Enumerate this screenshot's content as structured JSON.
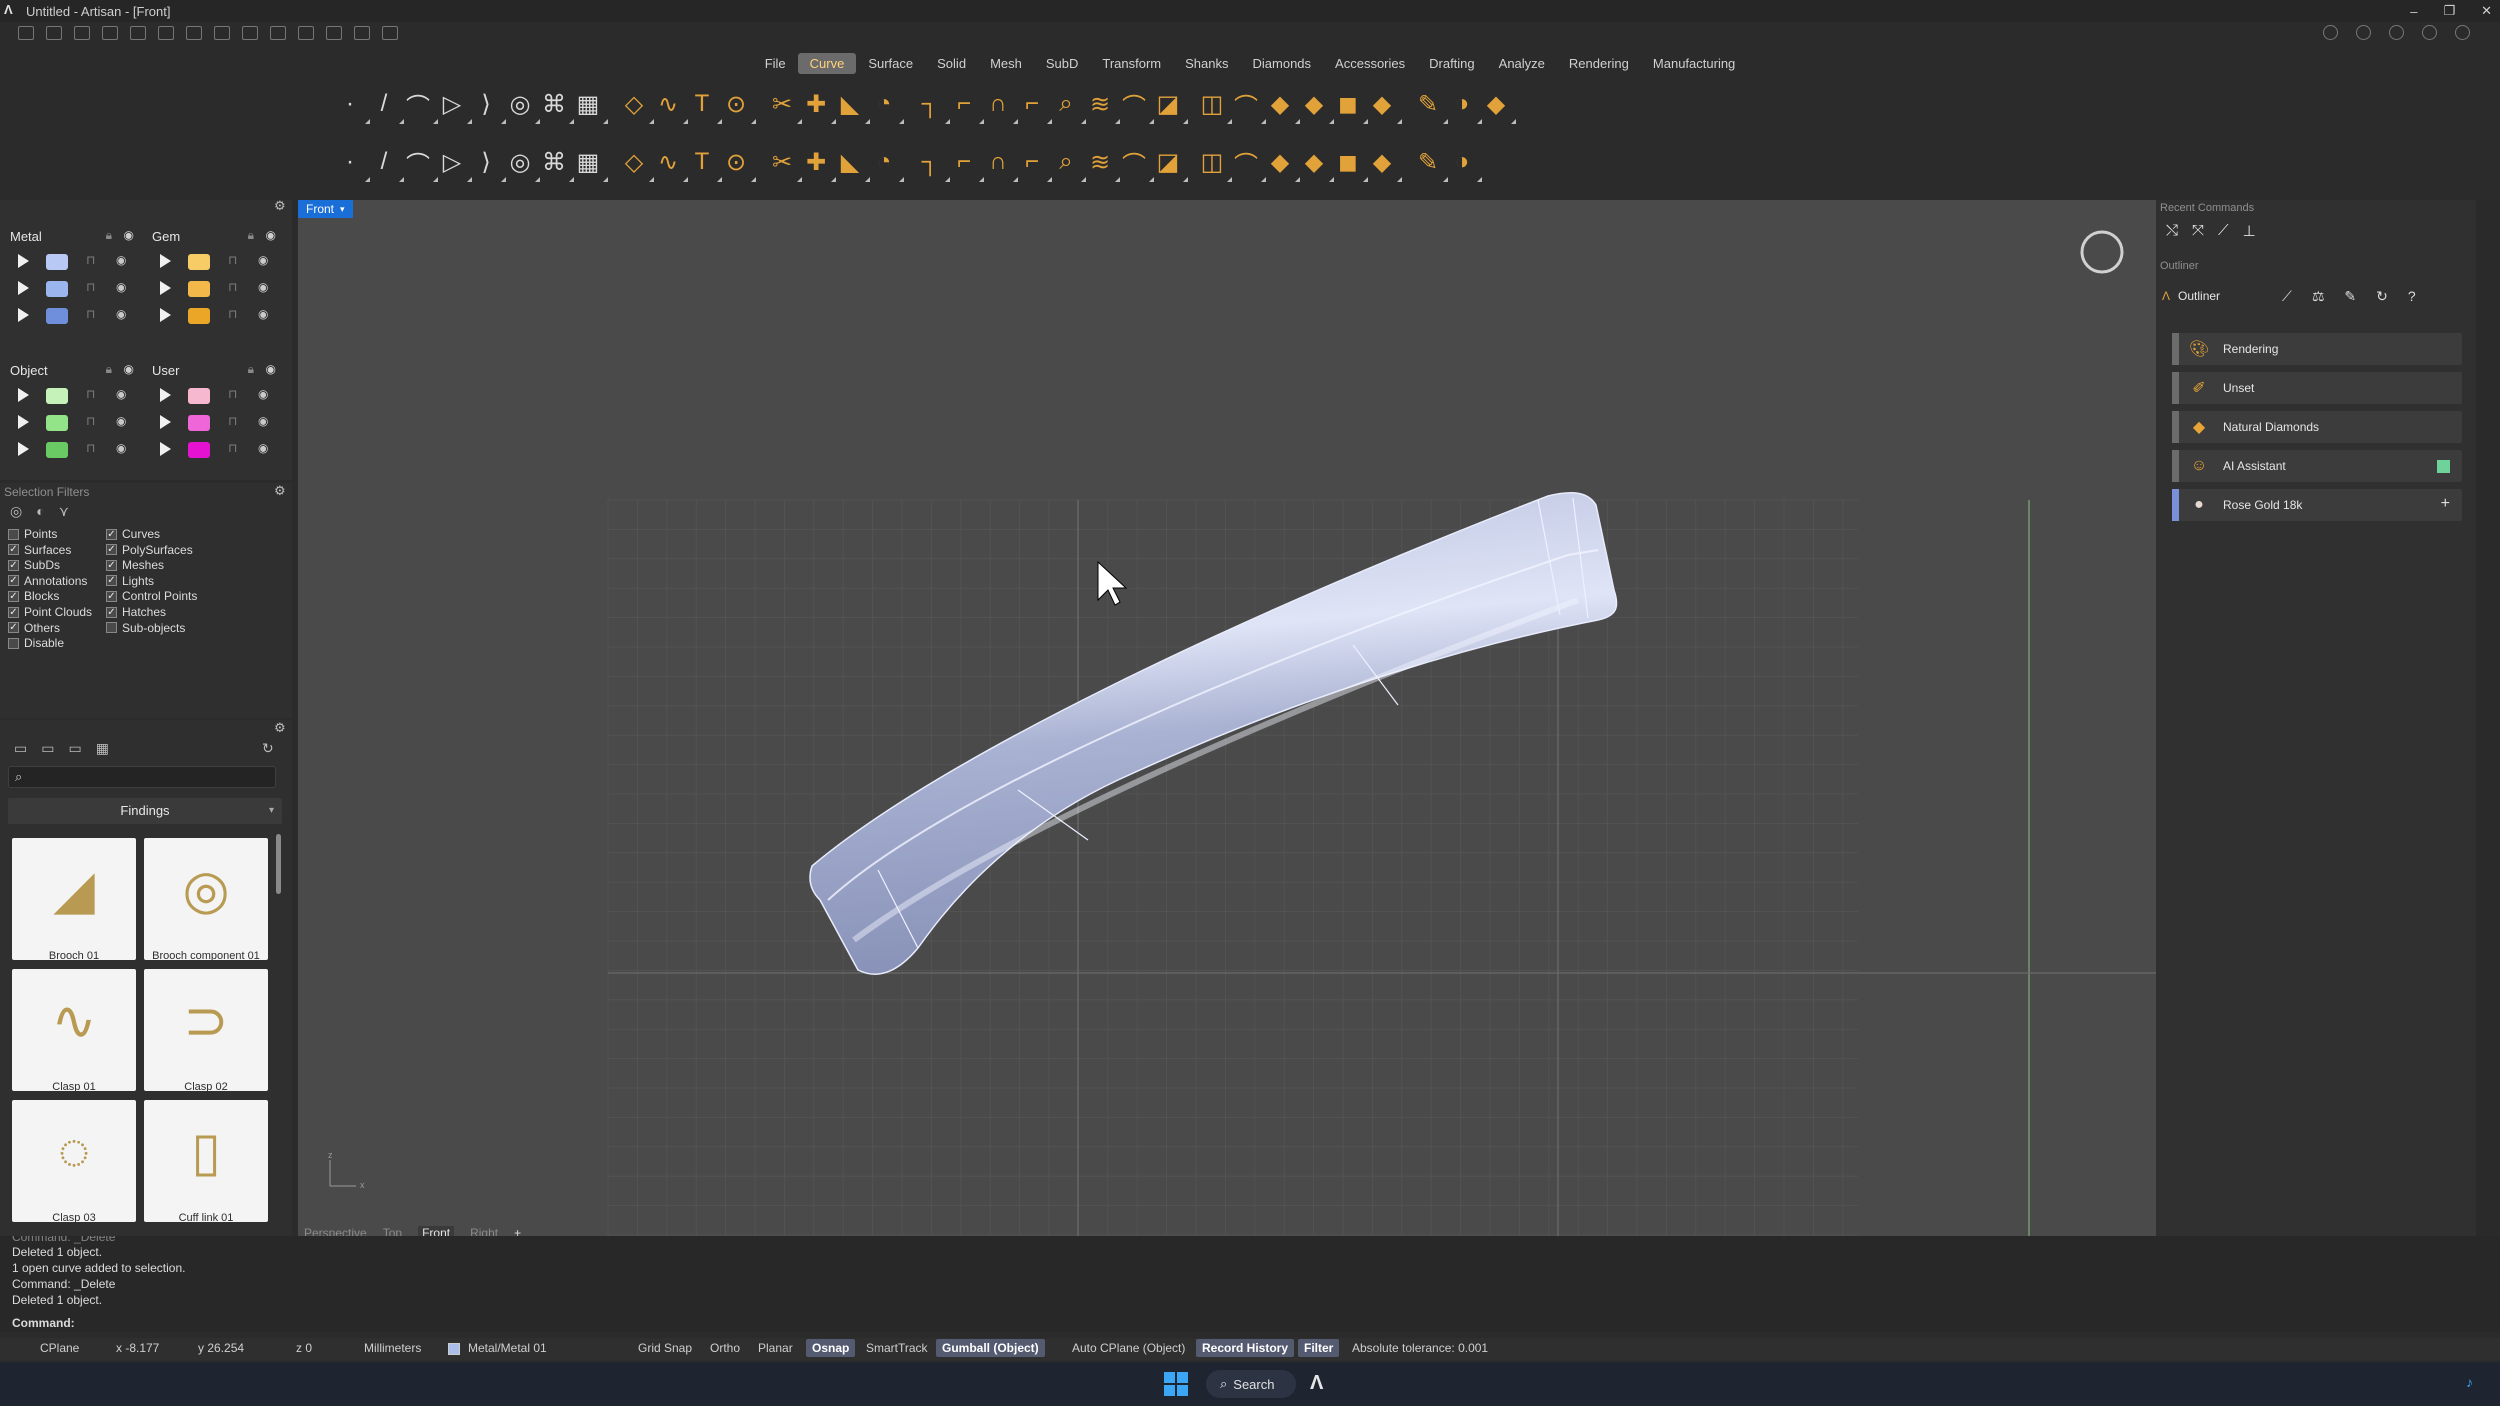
{
  "window": {
    "title": "Untitled - Artisan - [Front]",
    "buttons": [
      "–",
      "❐",
      "✕"
    ]
  },
  "menu": {
    "tabs": [
      "File",
      "Curve",
      "Surface",
      "Solid",
      "Mesh",
      "SubD",
      "Transform",
      "Shanks",
      "Diamonds",
      "Accessories",
      "Drafting",
      "Analyze",
      "Rendering",
      "Manufacturing"
    ],
    "active": "Curve"
  },
  "layers": {
    "groups": [
      {
        "name": "Metal",
        "colors": [
          "#b9c9f5",
          "#9bb6ef",
          "#6f8fdc"
        ]
      },
      {
        "name": "Gem",
        "colors": [
          "#f7cb66",
          "#f3b84a",
          "#eba628"
        ]
      },
      {
        "name": "Object",
        "colors": [
          "#c5f2b8",
          "#93e389",
          "#6acb65"
        ]
      },
      {
        "name": "User",
        "colors": [
          "#f6b8cf",
          "#ee66d8",
          "#e512d1"
        ]
      }
    ]
  },
  "selection_filters": {
    "title": "Selection Filters",
    "left": [
      {
        "label": "Points",
        "checked": false
      },
      {
        "label": "Surfaces",
        "checked": true
      },
      {
        "label": "SubDs",
        "checked": true
      },
      {
        "label": "Annotations",
        "checked": true
      },
      {
        "label": "Blocks",
        "checked": true
      },
      {
        "label": "Point Clouds",
        "checked": true
      },
      {
        "label": "Others",
        "checked": true
      },
      {
        "label": "Disable",
        "checked": false
      }
    ],
    "right": [
      {
        "label": "Curves",
        "checked": true
      },
      {
        "label": "PolySurfaces",
        "checked": true
      },
      {
        "label": "Meshes",
        "checked": true
      },
      {
        "label": "Lights",
        "checked": true
      },
      {
        "label": "Control Points",
        "checked": true
      },
      {
        "label": "Hatches",
        "checked": true
      },
      {
        "label": "Sub-objects",
        "checked": false
      }
    ]
  },
  "library": {
    "category": "Findings",
    "items": [
      "Brooch 01",
      "Brooch component 01",
      "Clasp 01",
      "Clasp 02",
      "Clasp 03",
      "Cuff link 01"
    ]
  },
  "viewport": {
    "active_view": "Front",
    "view_tabs": [
      "Perspective",
      "Top",
      "Front",
      "Right"
    ],
    "add_tab": "+",
    "axis_z": "z",
    "axis_x": "x"
  },
  "recent_commands": {
    "title": "Recent Commands"
  },
  "outliner": {
    "section": "Outliner",
    "title": "Outliner",
    "items": [
      {
        "label": "Rendering",
        "icon": "palette-icon"
      },
      {
        "label": "Unset",
        "icon": "brush-icon"
      },
      {
        "label": "Natural Diamonds",
        "icon": "diamond-icon"
      },
      {
        "label": "AI Assistant",
        "icon": "assistant-icon"
      },
      {
        "label": "Rose Gold 18k",
        "icon": "material-sphere-icon"
      }
    ]
  },
  "command_history": [
    "Command: _Delete",
    "Deleted 1 object.",
    "1 open curve added to selection.",
    "Command: _Delete",
    "Deleted 1 object."
  ],
  "command_prompt": "Command:",
  "status": {
    "cplane": "CPlane",
    "x": "x -8.177",
    "y": "y 26.254",
    "z": "z 0",
    "units": "Millimeters",
    "layer": "Metal/Metal 01",
    "layer_color": "#a9bde8",
    "toggles": [
      {
        "label": "Grid Snap",
        "on": false
      },
      {
        "label": "Ortho",
        "on": false
      },
      {
        "label": "Planar",
        "on": false
      },
      {
        "label": "Osnap",
        "on": true
      },
      {
        "label": "SmartTrack",
        "on": false
      },
      {
        "label": "Gumball (Object)",
        "on": true
      },
      {
        "label": "Auto CPlane (Object)",
        "on": false
      },
      {
        "label": "Record History",
        "on": true
      },
      {
        "label": "Filter",
        "on": true
      }
    ],
    "tolerance": "Absolute tolerance: 0.001"
  },
  "taskbar": {
    "search": "Search"
  },
  "colors": {
    "accent_orange": "#e2a23a",
    "active_tab_blue": "#1a6ed8",
    "viewport_bg": "#4a4a4a"
  }
}
